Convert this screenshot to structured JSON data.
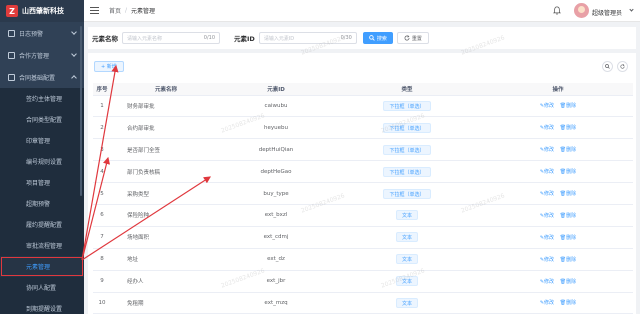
{
  "brand": {
    "name": "山西肇新科技",
    "logo_letter": "Z"
  },
  "sidebar": {
    "items": [
      {
        "label": "日志预警",
        "expanded": false
      },
      {
        "label": "合作方管理",
        "expanded": false
      },
      {
        "label": "合同基础配置",
        "expanded": true
      }
    ],
    "sub_items": [
      {
        "label": "签约主体管理",
        "active": false
      },
      {
        "label": "合同类型配置",
        "active": false
      },
      {
        "label": "印章管理",
        "active": false
      },
      {
        "label": "编号规则设置",
        "active": false
      },
      {
        "label": "项目管理",
        "active": false
      },
      {
        "label": "超期预警",
        "active": false
      },
      {
        "label": "履约提醒配置",
        "active": false
      },
      {
        "label": "审批流程管理",
        "active": false
      },
      {
        "label": "元素管理",
        "active": true
      },
      {
        "label": "协同人配置",
        "active": false
      },
      {
        "label": "到期提醒设置",
        "active": false
      }
    ]
  },
  "header": {
    "breadcrumb": [
      "首页",
      "元素管理"
    ],
    "user_name": "超级管理员"
  },
  "search": {
    "name_label": "元素名称",
    "name_placeholder": "请输入元素名称",
    "name_count": "0/10",
    "id_label": "元素ID",
    "id_placeholder": "请输入元素ID",
    "id_count": "0/30",
    "search_button": "搜索",
    "reset_button": "重置"
  },
  "toolbar": {
    "add_button": "+ 新增"
  },
  "table": {
    "columns": [
      "序号",
      "元素名称",
      "元素ID",
      "类型",
      "操作"
    ],
    "rows": [
      {
        "no": "1",
        "name": "财务部审批",
        "id": "caiwubu",
        "type": "下拉框（单选）"
      },
      {
        "no": "2",
        "name": "合约部审批",
        "id": "heyuebu",
        "type": "下拉框（单选）"
      },
      {
        "no": "3",
        "name": "是否部门全签",
        "id": "deptHuiQian",
        "type": "下拉框（单选）"
      },
      {
        "no": "4",
        "name": "部门负责核稿",
        "id": "deptHeGao",
        "type": "下拉框（单选）"
      },
      {
        "no": "5",
        "name": "采购类型",
        "id": "buy_type",
        "type": "下拉框（单选）"
      },
      {
        "no": "6",
        "name": "保险险种",
        "id": "ext_bxzl",
        "type": "文本"
      },
      {
        "no": "7",
        "name": "场地面积",
        "id": "ext_cdmj",
        "type": "文本"
      },
      {
        "no": "8",
        "name": "地址",
        "id": "ext_dz",
        "type": "文本"
      },
      {
        "no": "9",
        "name": "经办人",
        "id": "ext_jbr",
        "type": "文本"
      },
      {
        "no": "10",
        "name": "免租期",
        "id": "ext_mzq",
        "type": "文本"
      }
    ],
    "edit_label": "修改",
    "delete_label": "删除"
  },
  "watermark": "202508240926",
  "colors": {
    "sidebar": "#304156",
    "primary": "#409eff",
    "annotation": "#e0383e"
  }
}
